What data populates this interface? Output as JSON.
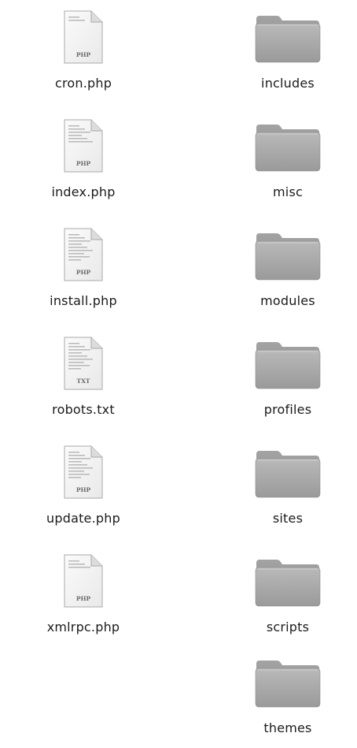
{
  "files": [
    {
      "name": "cron.php",
      "badge": "PHP",
      "icon": "php-file-icon",
      "lines": 2
    },
    {
      "name": "index.php",
      "badge": "PHP",
      "icon": "php-file-icon",
      "lines": 6
    },
    {
      "name": "install.php",
      "badge": "PHP",
      "icon": "php-file-icon",
      "lines": 9
    },
    {
      "name": "robots.txt",
      "badge": "TXT",
      "icon": "txt-file-icon",
      "lines": 9
    },
    {
      "name": "update.php",
      "badge": "PHP",
      "icon": "php-file-icon",
      "lines": 9
    },
    {
      "name": "xmlrpc.php",
      "badge": "PHP",
      "icon": "php-file-icon",
      "lines": 3
    }
  ],
  "folders": [
    {
      "name": "includes",
      "icon": "folder-icon"
    },
    {
      "name": "misc",
      "icon": "folder-icon"
    },
    {
      "name": "modules",
      "icon": "folder-icon"
    },
    {
      "name": "profiles",
      "icon": "folder-icon"
    },
    {
      "name": "sites",
      "icon": "folder-icon"
    },
    {
      "name": "scripts",
      "icon": "folder-icon"
    },
    {
      "name": "themes",
      "icon": "folder-icon"
    }
  ]
}
